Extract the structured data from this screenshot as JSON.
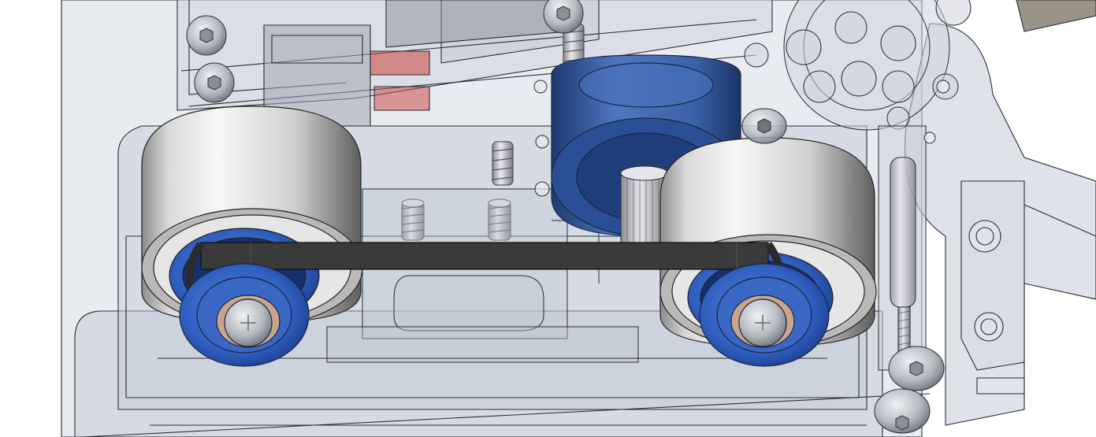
{
  "scene": {
    "subject": "",
    "colors": {
      "background": "#ffffff",
      "housing_fill": "#c8cfdc",
      "housing_edge": "#2a2c33",
      "roller_light": "#f2f2f2",
      "roller_mid": "#b9b9b9",
      "roller_dark": "#6e6e6e",
      "bearing_blue": "#2f5fc0",
      "bearing_blue_dark": "#1d3f8e",
      "motor_blue": "#3b62a8",
      "motor_blue_dark": "#1f3a70",
      "belt": "#3a3a3a",
      "screw_metal": "#a9adb4",
      "accent_red": "#c9504a"
    },
    "parts": {
      "rollers": 2,
      "motor_pulleys": 1,
      "belt_loops": 1,
      "screws_visible": 6,
      "springs_visible": 4
    }
  }
}
